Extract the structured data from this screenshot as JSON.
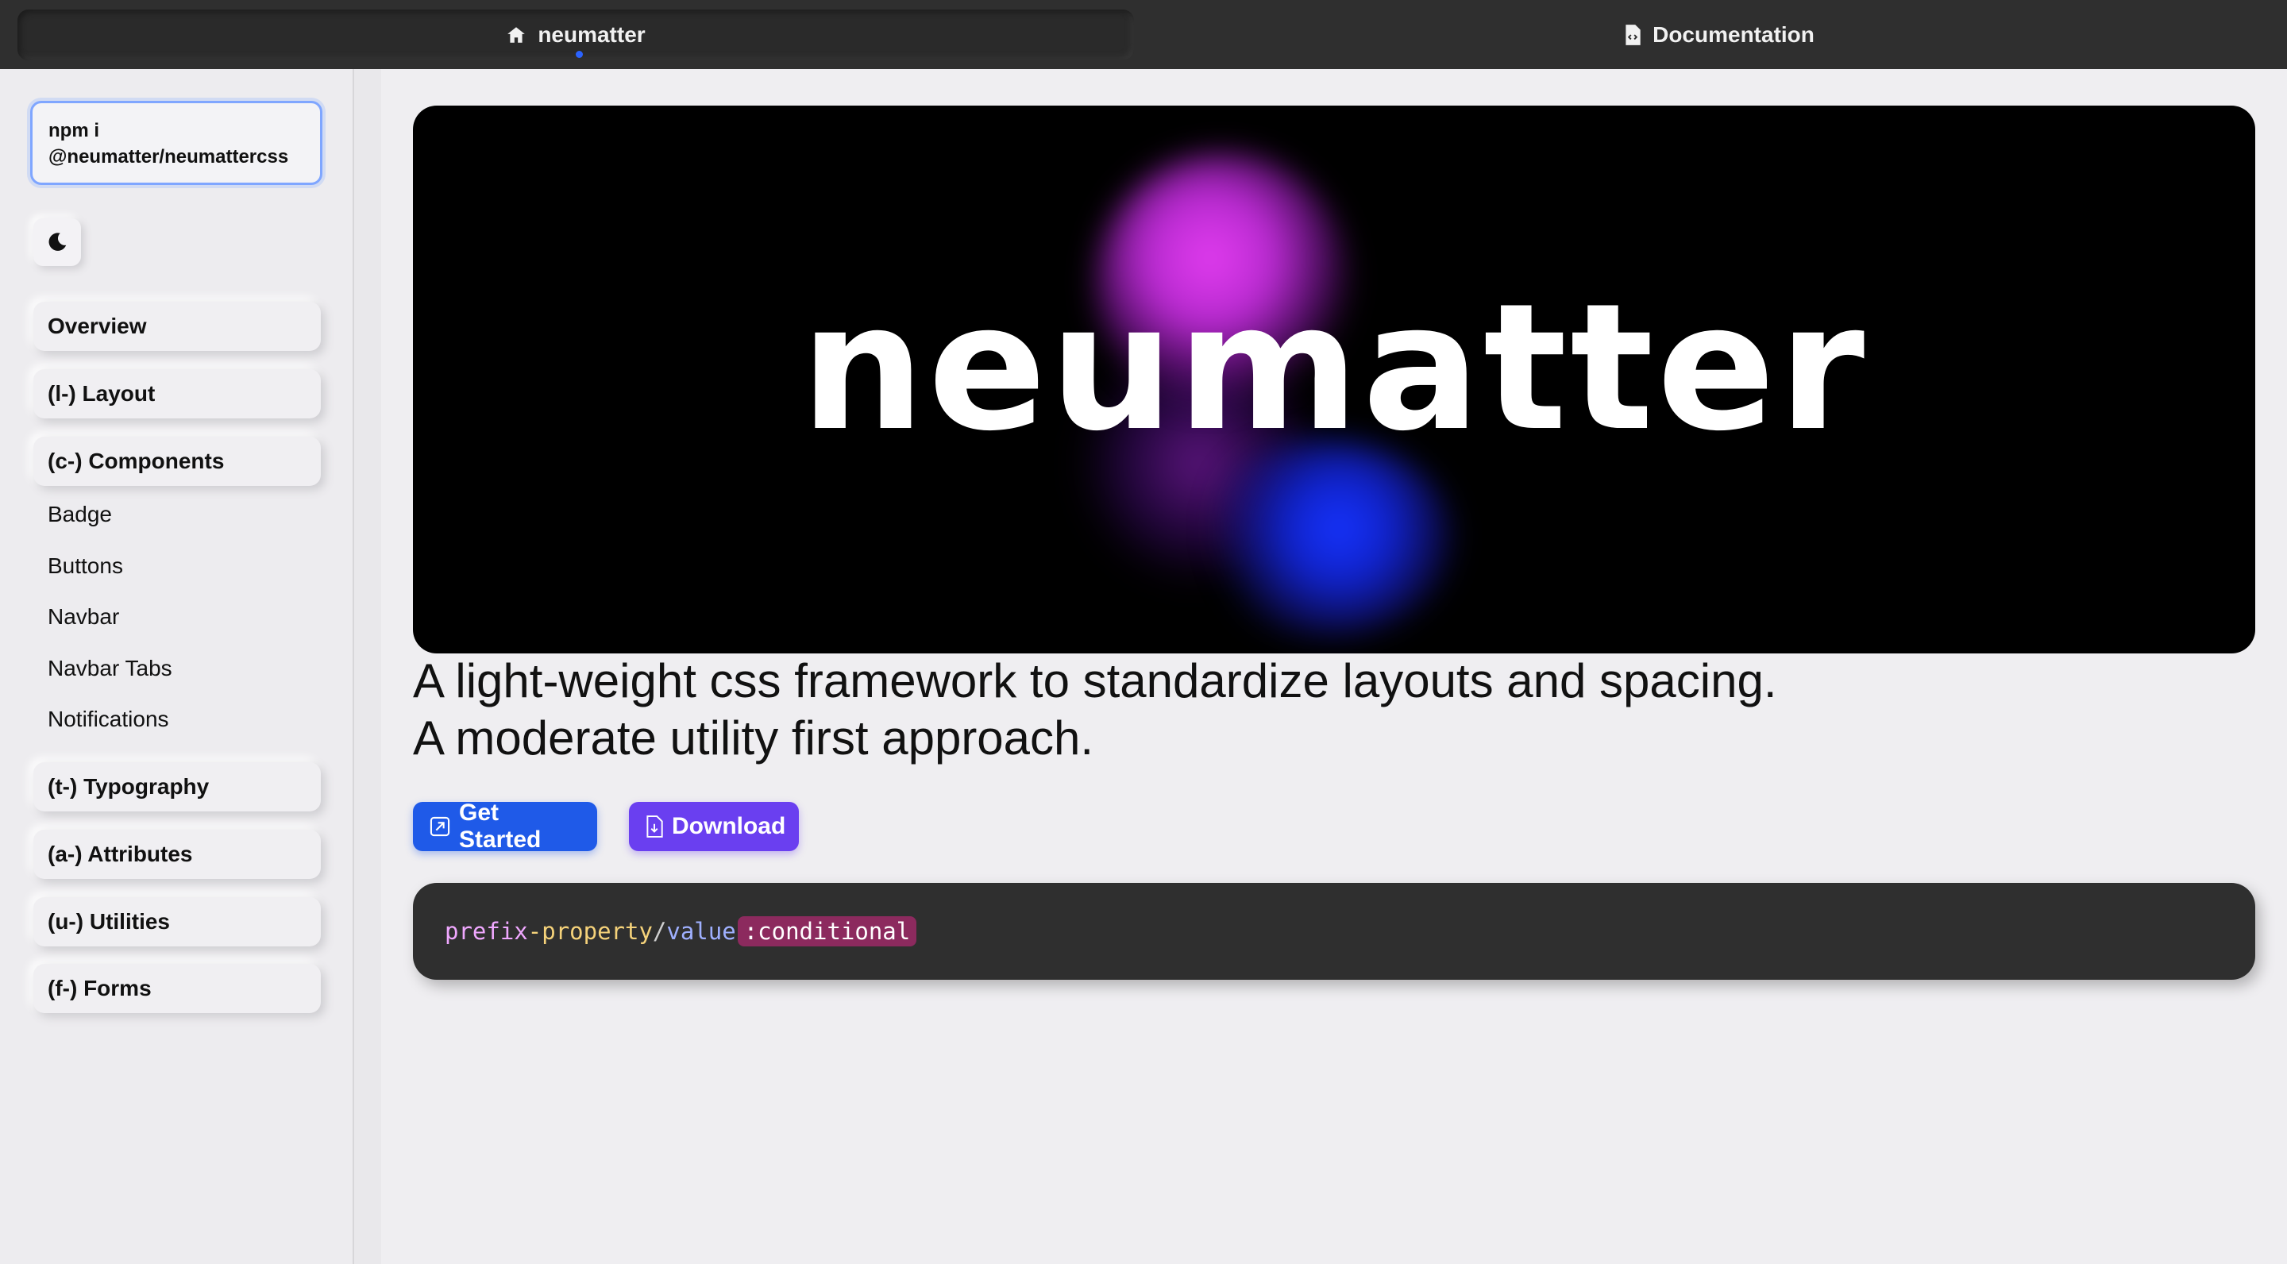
{
  "topnav": {
    "home_label": "neumatter",
    "docs_label": "Documentation"
  },
  "sidebar": {
    "install_command": "npm i @neumatter/neumattercss",
    "theme_toggle_icon": "moon-icon",
    "items": [
      {
        "label": "Overview"
      },
      {
        "label": "(l-) Layout"
      },
      {
        "label": "(c-) Components"
      },
      {
        "label": "(t-) Typography"
      },
      {
        "label": "(a-) Attributes"
      },
      {
        "label": "(u-) Utilities"
      },
      {
        "label": "(f-) Forms"
      }
    ],
    "components_subitems": [
      "Badge",
      "Buttons",
      "Navbar",
      "Navbar Tabs",
      "Notifications"
    ]
  },
  "hero": {
    "title": "neumatter"
  },
  "main": {
    "tagline_line1": "A light-weight css framework to standardize layouts and spacing.",
    "tagline_line2": "A moderate utility first approach.",
    "get_started_label": "Get Started",
    "download_label": "Download"
  },
  "code": {
    "prefix": "prefix",
    "dash": "-",
    "property": "property",
    "slash": "/",
    "value": "value",
    "conditional": ":conditional"
  },
  "colors": {
    "accent_blue": "#1f5ae8",
    "accent_purple": "#6a3ff0",
    "nav_bg": "#2f2f2f"
  }
}
